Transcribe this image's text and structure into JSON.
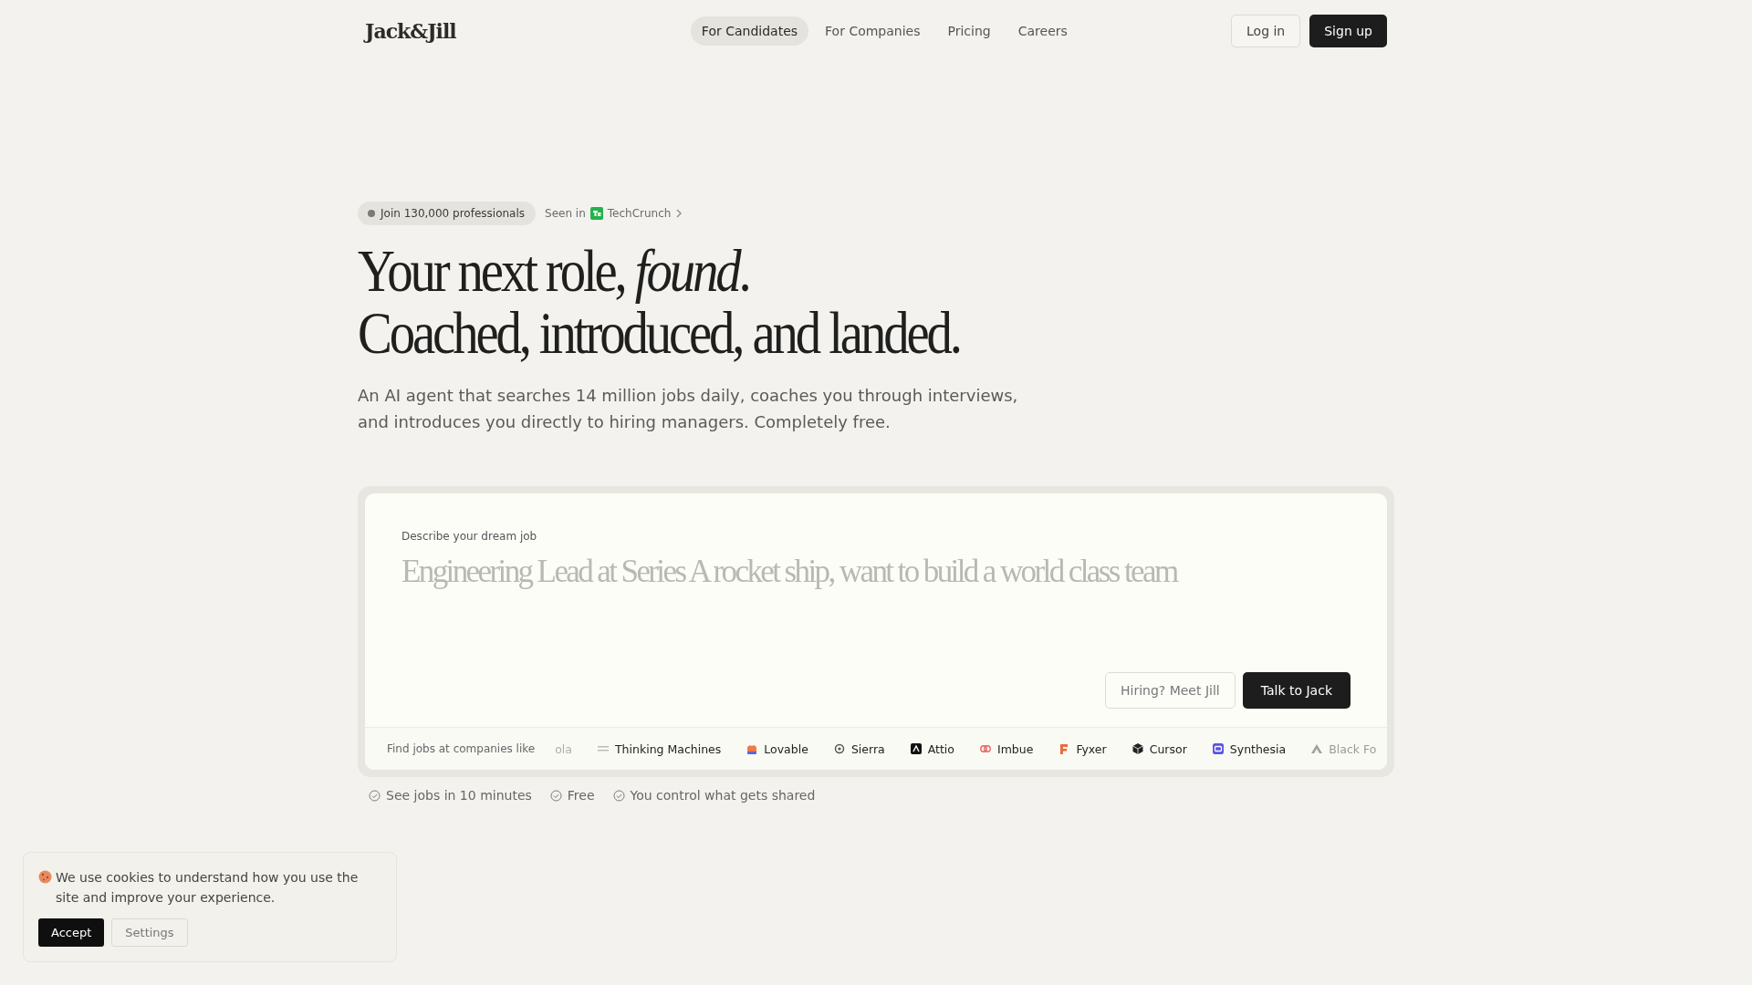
{
  "header": {
    "logo": "Jack&Jill",
    "nav": [
      {
        "label": "For Candidates",
        "selected": true
      },
      {
        "label": "For Companies",
        "selected": false
      },
      {
        "label": "Pricing",
        "selected": false
      },
      {
        "label": "Careers",
        "selected": false
      }
    ],
    "login": "Log in",
    "signup": "Sign up"
  },
  "hero": {
    "badge": "Join 130,000 professionals",
    "seen_in": "Seen in",
    "press": "TechCrunch",
    "headline": [
      "Your next role, *found*.",
      "Coached, introduced, and landed."
    ],
    "subtitle": "An AI agent that searches 14 million jobs daily, coaches you through interviews, and introduces you directly to hiring managers. Completely free."
  },
  "job_form": {
    "label": "Describe your dream job",
    "placeholder": "Engineering Lead at Series A rocket ship, want to build a world class team",
    "secondary_button": "Hiring? Meet Jill",
    "primary_button": "Talk to Jack"
  },
  "companies": {
    "label": "Find jobs at companies like",
    "items": [
      "ola",
      "Thinking Machines",
      "Lovable",
      "Sierra",
      "Attio",
      "Imbue",
      "Fyxer",
      "Cursor",
      "Synthesia",
      "Black Fo"
    ]
  },
  "features": [
    "See jobs in 10 minutes",
    "Free",
    "You control what gets shared"
  ],
  "cookie_banner": {
    "text": "We use cookies to understand how you use the site and improve your experience.",
    "accept": "Accept",
    "settings": "Settings"
  }
}
